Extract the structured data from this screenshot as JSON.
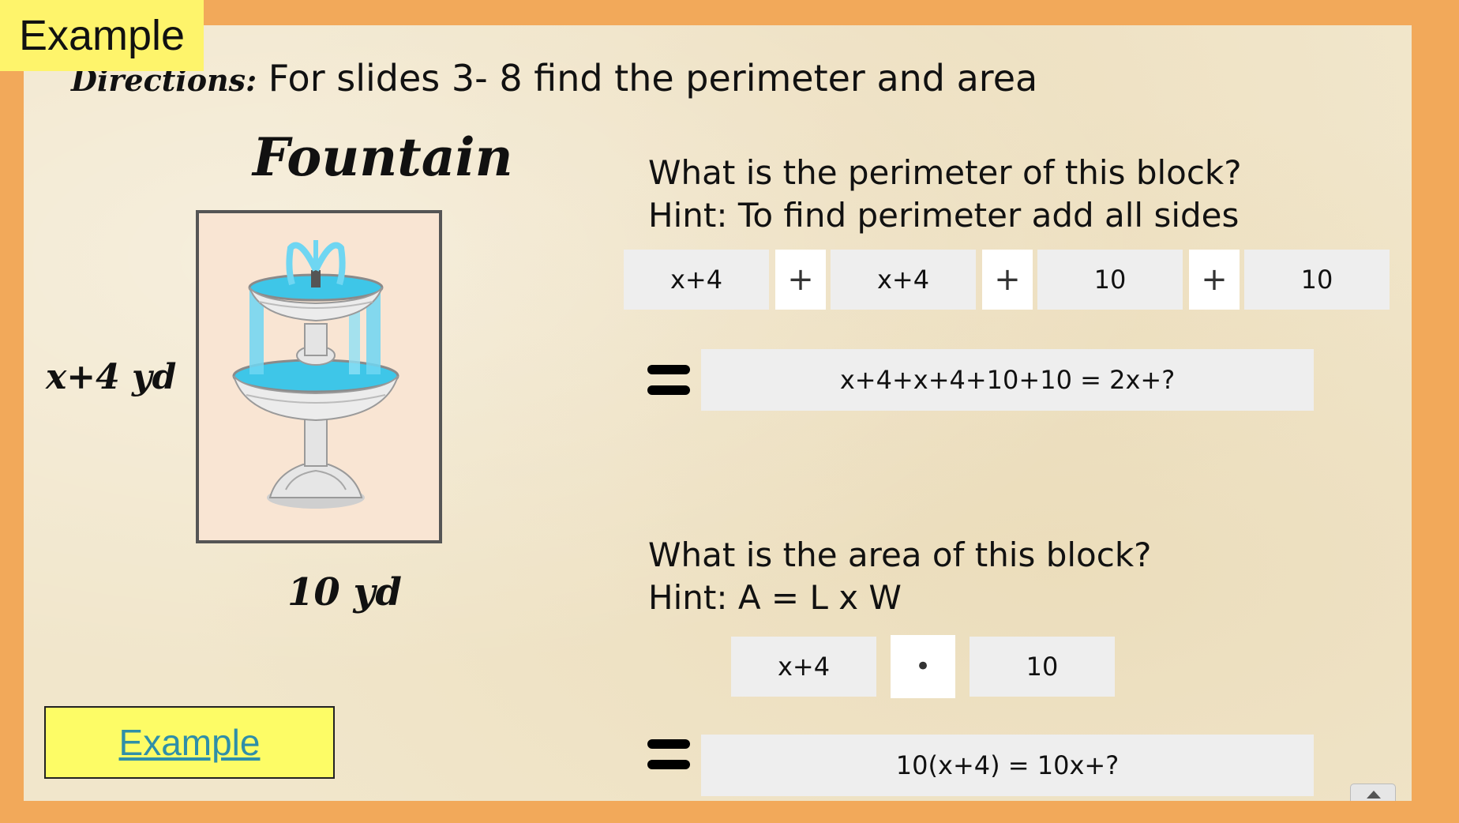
{
  "badge": {
    "label": "Example"
  },
  "directions": {
    "label": "Directions:",
    "text": " For slides 3- 8 find the perimeter and area"
  },
  "figure": {
    "title": "Fountain",
    "side_label": "x+4  yd",
    "bottom_label": "10  yd",
    "icon": "fountain-icon"
  },
  "perimeter": {
    "question": "What is the perimeter of this block?",
    "hint": "Hint: To find perimeter add  all sides",
    "terms": [
      "x+4",
      "x+4",
      "10",
      "10"
    ],
    "operator": "+",
    "result": "x+4+x+4+10+10 = 2x+?"
  },
  "area": {
    "question": "What is the area of this block?",
    "hint": "Hint: A = L x W",
    "terms": [
      "x+4",
      "10"
    ],
    "operator": "•",
    "result": "10(x+4) = 10x+?"
  },
  "example_button": {
    "label": "Example"
  },
  "colors": {
    "frame": "#f2a95a",
    "badge": "#fef46b",
    "button": "#fdfc66",
    "link": "#2f8fa8",
    "water": "#3ec6e8"
  }
}
